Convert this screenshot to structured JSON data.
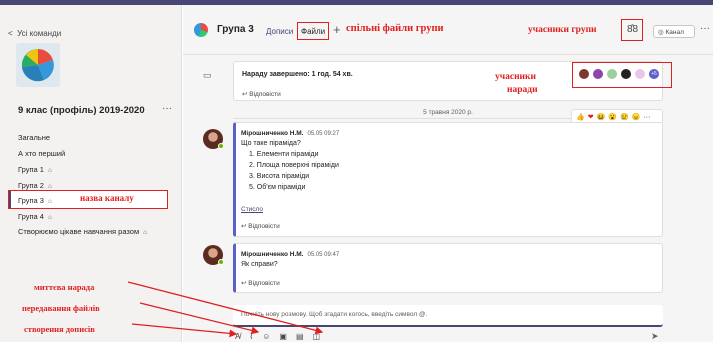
{
  "sidebar": {
    "back_label": "Усі команди",
    "team_name": "9 клас (профіль) 2019-2020",
    "more": "···",
    "channels": [
      {
        "label": "Загальне",
        "locked": false
      },
      {
        "label": "А хто перший",
        "locked": false
      },
      {
        "label": "Група 1",
        "locked": true
      },
      {
        "label": "Група 2",
        "locked": true
      },
      {
        "label": "Група 3",
        "locked": true,
        "active": true
      },
      {
        "label": "Група 4",
        "locked": true
      },
      {
        "label": "Створюємо цікаве навчання разом",
        "locked": true
      }
    ],
    "lock_glyph": "🔒"
  },
  "header": {
    "channel_title": "Група 3",
    "tab_posts": "Дописи",
    "tab_files": "Файли",
    "plus": "+",
    "channel_button": "◎ Канал",
    "more": "···"
  },
  "meeting": {
    "text": "Нараду завершено: 1 год. 54 хв.",
    "reply": "↩ Відповісти",
    "extra_count": "+5"
  },
  "date_divider": "5 травня 2020 р.",
  "messages": [
    {
      "author": "Мірошниченко Н.М.",
      "time": "05.05 09:27",
      "lines": [
        "Що таке піраміда?",
        "1. Елементи піраміди",
        "2. Площа поверхні піраміди",
        "3. Висота піраміди",
        "5. Об'єм піраміди"
      ],
      "collapse": "Стисло",
      "reply": "↩ Відповісти"
    },
    {
      "author": "Мірошниченко Н.М.",
      "time": "05.05 09:47",
      "lines": [
        "Як справи?"
      ],
      "reply": "↩ Відповісти"
    }
  ],
  "compose": {
    "placeholder": "Почніть нову розмову. Щоб згадати когось, введіть символ @."
  },
  "reactions": [
    "👍",
    "❤",
    "😆",
    "😮",
    "😢",
    "😠"
  ],
  "annotations": {
    "shared_files": "спільні файли групи",
    "group_members": "учасники групи",
    "meeting_members_1": "учасники",
    "meeting_members_2": "наради",
    "channel_name": "назва каналу",
    "instant_meeting": "миттєва нарада",
    "file_transfer": "передавання файлів",
    "create_posts": "створення дописів"
  },
  "colors": {
    "accent": "#464775",
    "annotation": "#e02020",
    "online": "#6bb700"
  }
}
